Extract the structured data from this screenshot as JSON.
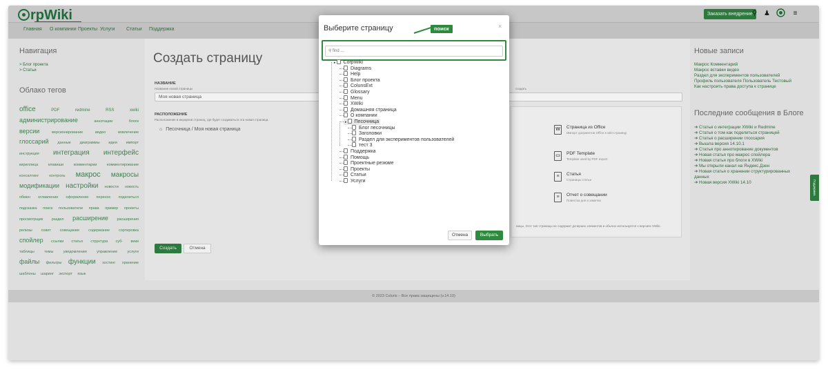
{
  "header": {
    "logo": "rpWiki",
    "order_button": "Заказать внедрение",
    "icons": [
      "search-icon",
      "bell-icon",
      "globe-icon",
      "menu-icon"
    ]
  },
  "nav": [
    "Главная",
    "О компании",
    "Проекты",
    "Услуги",
    "Статьи",
    "Поддержка"
  ],
  "left": {
    "nav_title": "Навигация",
    "nav_links": [
      "> Блог проекта",
      "> Статьи"
    ],
    "cloud_title": "Облако тегов",
    "cloud": [
      {
        "t": "office",
        "s": 10
      },
      {
        "t": "PDF",
        "s": 6
      },
      {
        "t": "redmine",
        "s": 6
      },
      {
        "t": "RSS",
        "s": 6
      },
      {
        "t": "xwiki",
        "s": 6
      },
      {
        "t": "администрирование",
        "s": 9
      },
      {
        "t": "аннотации",
        "s": 5.5
      },
      {
        "t": "блоги",
        "s": 5.5
      },
      {
        "t": "версии",
        "s": 9
      },
      {
        "t": "версионирование",
        "s": 5.5
      },
      {
        "t": "видео",
        "s": 5.5
      },
      {
        "t": "вовлечение",
        "s": 5.5
      },
      {
        "t": "глоссарий",
        "s": 9
      },
      {
        "t": "данные",
        "s": 5.5
      },
      {
        "t": "диаграммы",
        "s": 5.5
      },
      {
        "t": "идеи",
        "s": 5.5
      },
      {
        "t": "импорт",
        "s": 5.5
      },
      {
        "t": "инструкция",
        "s": 5.5
      },
      {
        "t": "интеграция",
        "s": 10
      },
      {
        "t": "интерфейс",
        "s": 10
      },
      {
        "t": "кириллица",
        "s": 5.5
      },
      {
        "t": "клавиши",
        "s": 5.5
      },
      {
        "t": "комментарии",
        "s": 5.5
      },
      {
        "t": "комментирование",
        "s": 5.5
      },
      {
        "t": "консалтинг",
        "s": 5.5
      },
      {
        "t": "контроль",
        "s": 5.5
      },
      {
        "t": "макрос",
        "s": 11
      },
      {
        "t": "макросы",
        "s": 10
      },
      {
        "t": "модификации",
        "s": 9
      },
      {
        "t": "настройки",
        "s": 10
      },
      {
        "t": "новости",
        "s": 5.5
      },
      {
        "t": "новость",
        "s": 5.5
      },
      {
        "t": "обмен",
        "s": 5.5
      },
      {
        "t": "оглавление",
        "s": 5.5
      },
      {
        "t": "оформление",
        "s": 5.5
      },
      {
        "t": "перенос",
        "s": 5.5
      },
      {
        "t": "поделиться",
        "s": 5.5
      },
      {
        "t": "подсказка",
        "s": 5.5
      },
      {
        "t": "поиск",
        "s": 5.5
      },
      {
        "t": "пользователи",
        "s": 5.5
      },
      {
        "t": "права",
        "s": 5.5
      },
      {
        "t": "пример",
        "s": 5.5
      },
      {
        "t": "проекты",
        "s": 5.5
      },
      {
        "t": "просмотрщик",
        "s": 5.5
      },
      {
        "t": "раздел",
        "s": 5.5
      },
      {
        "t": "расширение",
        "s": 9
      },
      {
        "t": "расширения",
        "s": 5.5
      },
      {
        "t": "релизы",
        "s": 5.5
      },
      {
        "t": "совет",
        "s": 5.5
      },
      {
        "t": "совещание",
        "s": 5.5
      },
      {
        "t": "содержание",
        "s": 5.5
      },
      {
        "t": "сортировка",
        "s": 5.5
      },
      {
        "t": "спойлер",
        "s": 9
      },
      {
        "t": "ссылки",
        "s": 5.5
      },
      {
        "t": "статья",
        "s": 5.5
      },
      {
        "t": "структура",
        "s": 5.5
      },
      {
        "t": "суб-",
        "s": 5.5
      },
      {
        "t": "вики",
        "s": 5.5
      },
      {
        "t": "таблицы",
        "s": 5.5
      },
      {
        "t": "темы",
        "s": 5.5
      },
      {
        "t": "уведомления",
        "s": 5.5
      },
      {
        "t": "управление",
        "s": 5.5
      },
      {
        "t": "услуги",
        "s": 5.5
      },
      {
        "t": "файлы",
        "s": 9
      },
      {
        "t": "фильтры",
        "s": 5.5
      },
      {
        "t": "функции",
        "s": 10
      },
      {
        "t": "хостинг",
        "s": 5.5
      },
      {
        "t": "хранение",
        "s": 5.5
      },
      {
        "t": "шаблоны",
        "s": 5.5
      },
      {
        "t": "шаринг",
        "s": 5.5
      },
      {
        "t": "экспорт",
        "s": 5.5
      },
      {
        "t": "язык",
        "s": 5.5
      }
    ]
  },
  "main": {
    "title": "Создать страницу",
    "name_label": "НАЗВАНИЕ",
    "name_hint": "Название новой страницы",
    "name_value": "Моя новая страница",
    "location_label": "РАСПОЛОЖЕНИЕ",
    "location_hint": "Расположение в иерархии страниц, где будет создаваться эта новая страница.",
    "location_path": "Песочница / Моя новая страница",
    "field_right_hint": "создать",
    "templates": [
      {
        "icon": "W",
        "title": "Страница из Office",
        "desc": "Импорт документов Office в wiki-страницу"
      },
      {
        "icon": "▭",
        "title": "PDF Template",
        "desc": "Template used by PDF export"
      },
      {
        "icon": "≡",
        "title": "Статья",
        "desc": "Страницы статьи"
      },
      {
        "icon": "≡",
        "title": "Отчет о совещании",
        "desc": "Повестка дня и заметки"
      }
    ],
    "bottom_note": "ницы. Этот тип страницы не содержит дочерних элементов и обычно используется\nх версиях XWiki.",
    "create_button": "Создать",
    "cancel_button": "Отмена"
  },
  "right": {
    "recent_title": "Новые записи",
    "recent": [
      "Макрос Комментарий",
      "Макрос вставки видео",
      "Раздел для экспериментов пользователей",
      "Профиль пользователя Пользователь Тестовый",
      "Как настроить права доступа к странице"
    ],
    "blog_title": "Последние сообщения в Блоге",
    "blog": [
      "➔ Статья о интеграции XWiki и Redmine",
      "➔ Статья о том как поделиться страницей",
      "➔ Статья о расширении глоссария",
      "➔ Вышла версия 14.10.1",
      "➔ Статья про аннотирование документов",
      "➔ Новая статья про макрос спойлера",
      "➔ Новая статья про блоги в XWiki",
      "➔ Мы открыли канал на Яндекс.Дзен",
      "➔ Новая статья о хранении структурированных",
      "данных",
      "➔ Новая версия XWiki 14.10"
    ],
    "feedback_tab": "Поддержка"
  },
  "footer": "© 2023 Coluris – Все права защищены (v.14.10)",
  "modal": {
    "title": "Выберите страницу",
    "close": "×",
    "callout": "поиск",
    "search_placeholder": "find ...",
    "tree": [
      {
        "label": "CorpWiki",
        "level": 0,
        "root": true
      },
      {
        "label": "Diagrams",
        "level": 1
      },
      {
        "label": "Help",
        "level": 1
      },
      {
        "label": "Блог проекта",
        "level": 1
      },
      {
        "label": "ColunsExt",
        "level": 1
      },
      {
        "label": "Glossary",
        "level": 1
      },
      {
        "label": "Menu",
        "level": 1
      },
      {
        "label": "XWiki",
        "level": 1
      },
      {
        "label": "Домашняя страница",
        "level": 1
      },
      {
        "label": "О компании",
        "level": 1
      },
      {
        "label": "Песочница",
        "level": 1,
        "selected": true
      },
      {
        "label": "Блог песочницы",
        "level": 2
      },
      {
        "label": "Заголовки",
        "level": 2
      },
      {
        "label": "Раздел для экспериментов пользователей",
        "level": 2
      },
      {
        "label": "тест 3",
        "level": 2
      },
      {
        "label": "Поддержка",
        "level": 1
      },
      {
        "label": "Помощь",
        "level": 1
      },
      {
        "label": "Проектные резюме",
        "level": 1
      },
      {
        "label": "Проекты",
        "level": 1
      },
      {
        "label": "Статьи",
        "level": 1
      },
      {
        "label": "Услуги",
        "level": 1
      }
    ],
    "cancel_button": "Отмена",
    "select_button": "Выбрать"
  },
  "colors": {
    "brand": "#2e7a3e",
    "callout": "#2e8b3e"
  }
}
